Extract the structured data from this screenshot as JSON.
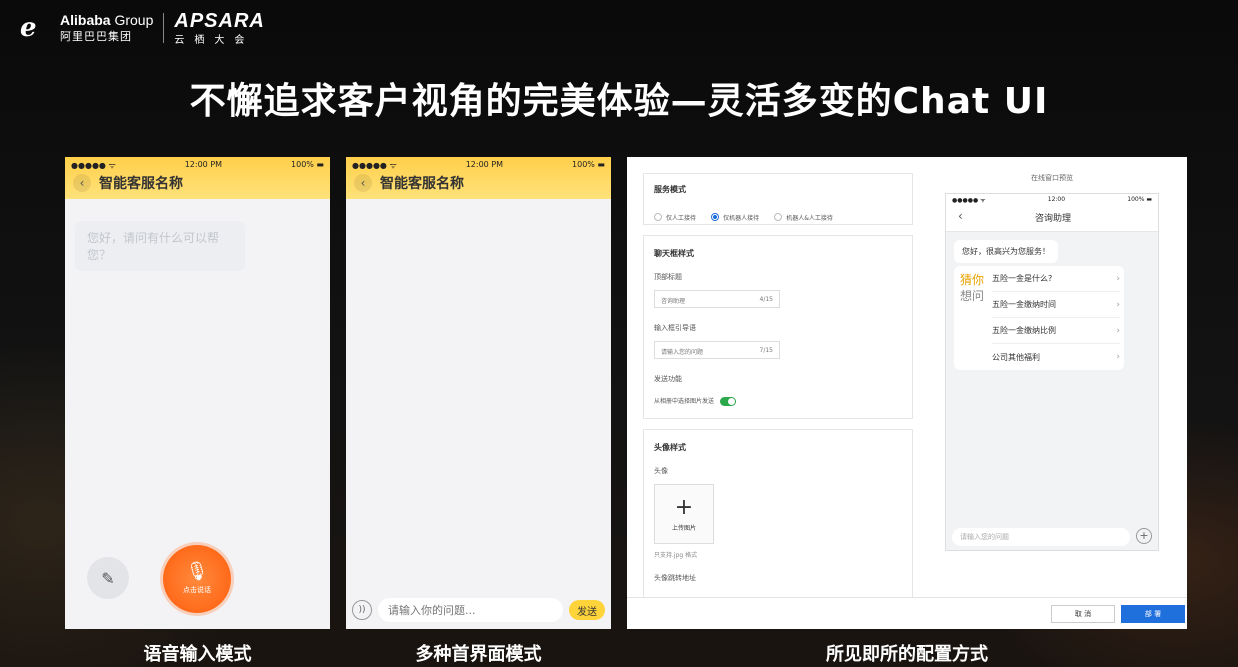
{
  "brand": {
    "alibaba_en": "Alibaba",
    "alibaba_group": "Group",
    "alibaba_cn": "阿里巴巴集团",
    "apsara_en": "APSARA",
    "apsara_cn": "云栖大会"
  },
  "title": "不懈追求客户视角的完美体验—灵活多变的Chat UI",
  "captions": [
    "语音输入模式",
    "多种首界面模式",
    "所见即所的配置方式"
  ],
  "phone1": {
    "status_left": "●●●●● ᯤ",
    "status_time": "12:00 PM",
    "status_battery": "100% ▬",
    "back_icon": "‹",
    "title": "智能客服名称",
    "greeting": "您好，请问有什么可以帮您？",
    "edit_icon": "✎",
    "mic_icon": "🎙",
    "voice_label": "点击说话"
  },
  "phone2": {
    "status_left": "●●●●● ᯤ",
    "status_time": "12:00 PM",
    "status_battery": "100% ▬",
    "back_icon": "‹",
    "title": "智能客服名称",
    "voice_icon": "))",
    "input_placeholder": "请输入你的问题...",
    "send_label": "发送"
  },
  "config": {
    "service_mode": {
      "heading": "服务模式",
      "options": [
        "仅人工接待",
        "仅机器人接待",
        "机器人&人工接待"
      ],
      "selected": 1
    },
    "chat_style": {
      "heading": "聊天框样式",
      "top_title_label": "顶部标题",
      "top_title_value": "咨询助理",
      "top_title_count": "4/15",
      "guide_label": "输入框引导语",
      "guide_value": "请输入您的问题",
      "guide_count": "7/15",
      "send_label": "发送功能",
      "album_label": "从相册中选择图片发送",
      "album_enabled": true
    },
    "avatar": {
      "heading": "头像样式",
      "avatar_label": "头像",
      "upload_plus": "+",
      "upload_label": "上传图片",
      "hint": "只支持.jpg 格式",
      "jump_label": "头像跳转地址"
    },
    "buttons": {
      "cancel": "取 消",
      "deploy": "部 署"
    },
    "preview": {
      "label": "在线窗口预览",
      "status_left": "●●●●● ᯤ",
      "status_time": "12:00",
      "status_battery": "100% ▬",
      "back_icon": "‹",
      "title": "咨询助理",
      "greeting": "您好，很高兴为您服务！",
      "guess_top": "猜你",
      "guess_bottom": "想问",
      "questions": [
        "五险一金是什么?",
        "五险一金缴纳时间",
        "五险一金缴纳比例",
        "公司其他福利"
      ],
      "input_placeholder": "请输入您的问题",
      "plus_icon": "+"
    }
  }
}
